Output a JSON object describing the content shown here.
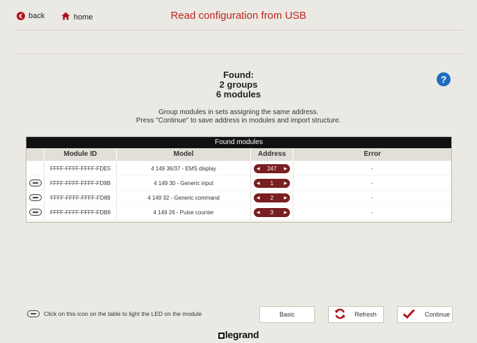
{
  "nav": {
    "back_label": "back",
    "home_label": "home"
  },
  "header": {
    "title": "Read configuration from USB"
  },
  "found": {
    "line1": "Found:",
    "line2": "2 groups",
    "line3": "6 modules"
  },
  "help": {
    "label": "?"
  },
  "description": {
    "line1": "Group modules in sets assigning the same address.",
    "line2": "Press \"Continue\" to save address in modules and import structure."
  },
  "table": {
    "caption": "Found modules",
    "headers": {
      "module_id": "Module ID",
      "model": "Model",
      "address": "Address",
      "error": "Error"
    },
    "rows": [
      {
        "led": false,
        "module_id": "FFFF-FFFF-FFFF-FDE5",
        "model": "4 149 36/37 - EMS display",
        "address": "247",
        "error": "-"
      },
      {
        "led": true,
        "module_id": "FFFF-FFFF-FFFF-FD9B",
        "model": "4 149 30 - Generic input",
        "address": "1",
        "error": "-"
      },
      {
        "led": true,
        "module_id": "FFFF-FFFF-FFFF-FD89",
        "model": "4 149 32 - Generic command",
        "address": "2",
        "error": "-"
      },
      {
        "led": true,
        "module_id": "FFFF-FFFF-FFFF-FDB8",
        "model": "4 149 26 - Pulse counter",
        "address": "3",
        "error": "-"
      }
    ]
  },
  "footer": {
    "note": "Click on this icon on the table to light the LED on the module",
    "basic_label": "Basic",
    "refresh_label": "Refresh",
    "continue_label": "Continue",
    "brand": "legrand"
  },
  "colors": {
    "accent": "#c0241f",
    "address_pill": "#7a1f1f",
    "help": "#1f6dc0",
    "background": "#ebe9e3"
  }
}
